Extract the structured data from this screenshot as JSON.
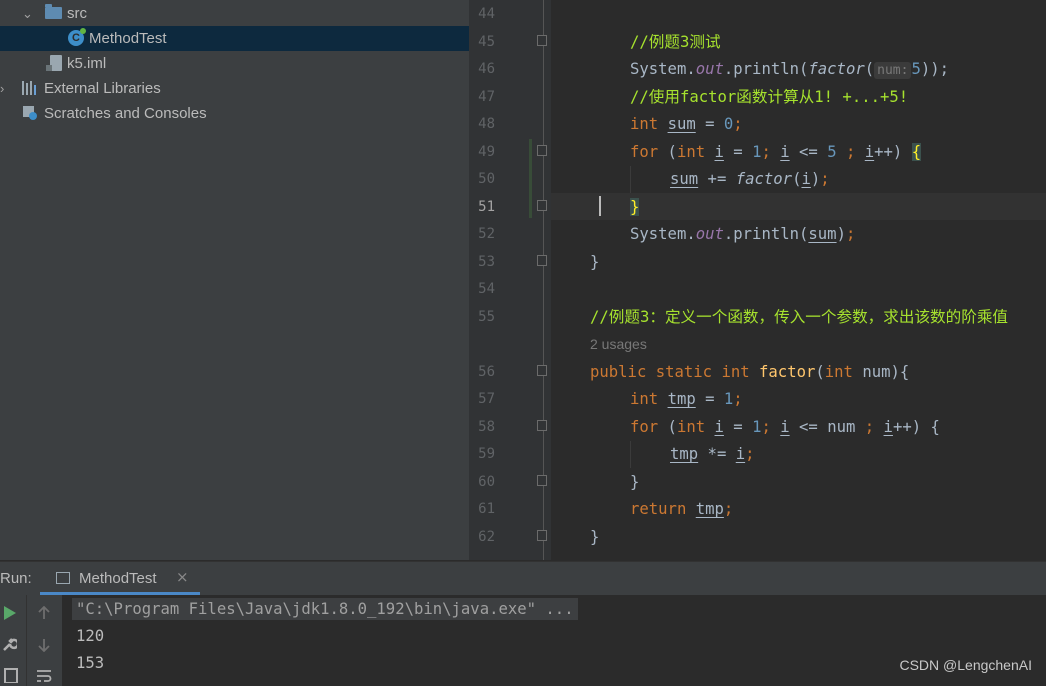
{
  "project_tree": [
    {
      "label": "src",
      "icon": "folder-icon",
      "expanded": true,
      "selected": false
    },
    {
      "label": "MethodTest",
      "icon": "java-class-icon",
      "selected": true
    },
    {
      "label": "k5.iml",
      "icon": "iml-file-icon",
      "selected": false
    },
    {
      "label": "External Libraries",
      "icon": "libraries-icon",
      "expanded": false
    },
    {
      "label": "Scratches and Consoles",
      "icon": "scratches-icon"
    }
  ],
  "editor": {
    "current_line": 51,
    "line_numbers": [
      "44",
      "45",
      "46",
      "47",
      "48",
      "49",
      "50",
      "51",
      "52",
      "53",
      "54",
      "55",
      "56",
      "57",
      "58",
      "59",
      "60",
      "61",
      "62"
    ],
    "usages_hint": "2 usages",
    "param_hint": "num:",
    "lines": {
      "l45": "//例题3测试",
      "l46_a": "System.",
      "l46_b": "out",
      "l46_c": ".println(",
      "l46_d": "factor",
      "l46_e": "(",
      "l46_f": "5",
      "l46_g": "));",
      "l47": "//使用factor函数计算从1! +...+5!",
      "kw_int": "int",
      "kw_for": "for",
      "kw_public": "public",
      "kw_static": "static",
      "kw_return": "return",
      "var_sum": "sum",
      "var_i": "i",
      "var_tmp": "tmp",
      "var_num": "num",
      "fn_factor": "factor",
      "n0": "0",
      "n1": "1",
      "n5": "5",
      "l55": "//例题3：定义一个函数，传入一个参数，求出该数的阶乘值"
    }
  },
  "run_panel": {
    "label": "Run:",
    "tab_label": "MethodTest",
    "console_lines": [
      "\"C:\\Program Files\\Java\\jdk1.8.0_192\\bin\\java.exe\" ...",
      "120",
      "153"
    ]
  },
  "watermark": "CSDN @LengchenAI",
  "colors": {
    "keyword": "#cc7832",
    "number": "#6897bb",
    "static_field": "#9876aa",
    "method": "#ffc66d",
    "comment": "#a6e22e",
    "run_green": "#59a869"
  }
}
